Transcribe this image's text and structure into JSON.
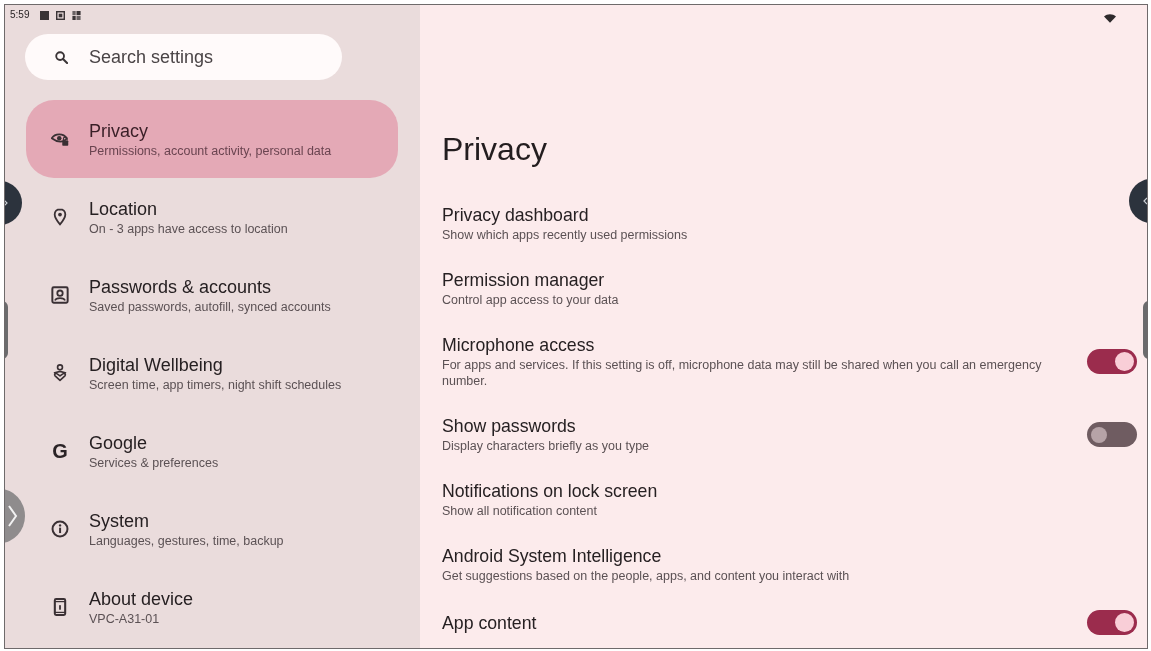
{
  "status_bar": {
    "time": "5:59"
  },
  "search": {
    "placeholder": "Search settings"
  },
  "sidebar": {
    "items": [
      {
        "title": "Privacy",
        "subtitle": "Permissions, account activity, personal data",
        "selected": true
      },
      {
        "title": "Location",
        "subtitle": "On - 3 apps have access to location",
        "selected": false
      },
      {
        "title": "Passwords & accounts",
        "subtitle": "Saved passwords, autofill, synced accounts",
        "selected": false
      },
      {
        "title": "Digital Wellbeing",
        "subtitle": "Screen time, app timers, night shift schedules",
        "selected": false
      },
      {
        "title": "Google",
        "subtitle": "Services & preferences",
        "selected": false,
        "icon_glyph": "G"
      },
      {
        "title": "System",
        "subtitle": "Languages, gestures, time, backup",
        "selected": false
      },
      {
        "title": "About device",
        "subtitle": "VPC-A31-01",
        "selected": false
      }
    ]
  },
  "page": {
    "title": "Privacy",
    "rows": [
      {
        "kind": "link",
        "title": "Privacy dashboard",
        "subtitle": "Show which apps recently used permissions"
      },
      {
        "kind": "link",
        "title": "Permission manager",
        "subtitle": "Control app access to your data"
      },
      {
        "kind": "toggle",
        "title": "Microphone access",
        "subtitle": "For apps and services. If this setting is off, microphone data may still be shared when you call an emergency number.",
        "on": true
      },
      {
        "kind": "toggle",
        "title": "Show passwords",
        "subtitle": "Display characters briefly as you type",
        "on": false
      },
      {
        "kind": "link",
        "title": "Notifications on lock screen",
        "subtitle": "Show all notification content"
      },
      {
        "kind": "link",
        "title": "Android System Intelligence",
        "subtitle": "Get suggestions based on the people, apps, and content you interact with"
      },
      {
        "kind": "toggle",
        "title": "App content",
        "on": true
      }
    ]
  }
}
